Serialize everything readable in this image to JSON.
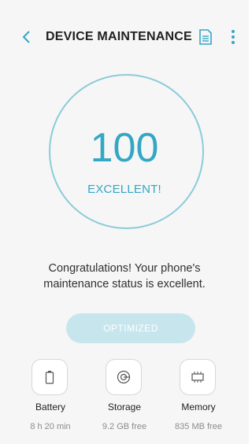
{
  "header": {
    "title": "DEVICE MAINTENANCE"
  },
  "score": {
    "value": "100",
    "label": "EXCELLENT!"
  },
  "message": "Congratulations! Your phone's maintenance status is excellent.",
  "action": {
    "label": "OPTIMIZED"
  },
  "stats": [
    {
      "name": "Battery",
      "value": "8 h 20 min",
      "icon": "battery-icon"
    },
    {
      "name": "Storage",
      "value": "9.2 GB free",
      "icon": "storage-icon"
    },
    {
      "name": "Memory",
      "value": "835 MB free",
      "icon": "memory-chip-icon"
    }
  ],
  "colors": {
    "accent": "#33a7c4",
    "ring": "#8ccbd9",
    "button_disabled": "#c7e5ed",
    "background": "#f6f6f6"
  }
}
